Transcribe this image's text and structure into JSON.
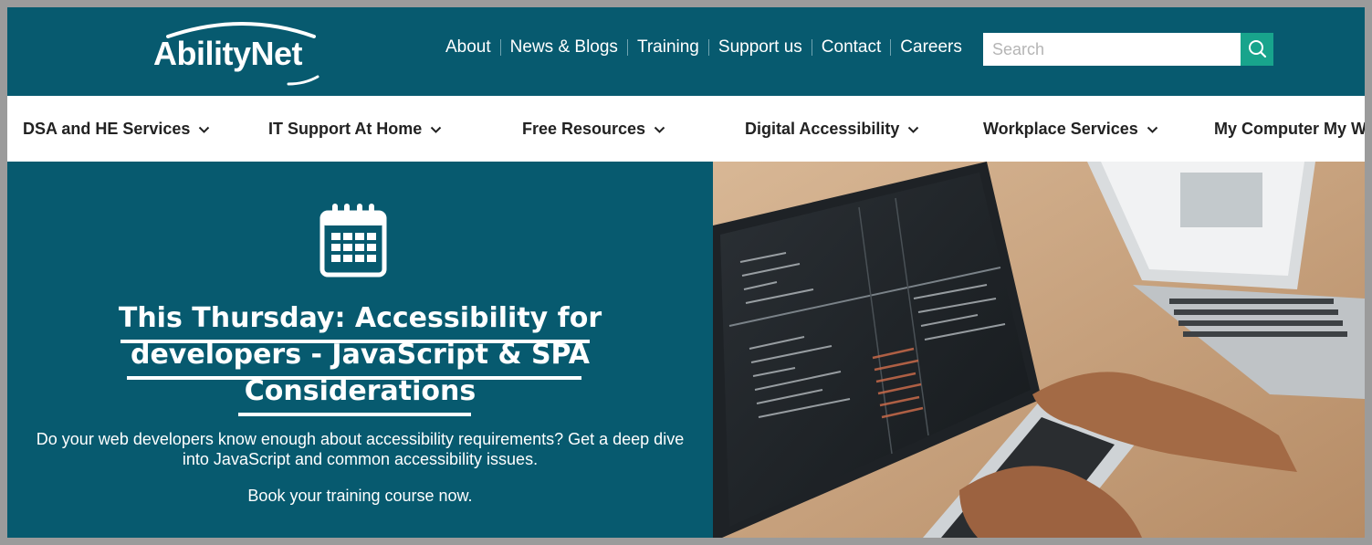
{
  "header": {
    "logo_text": "AbilityNet",
    "top_links": [
      "About",
      "News & Blogs",
      "Training",
      "Support us",
      "Contact",
      "Careers"
    ],
    "search": {
      "placeholder": "Search"
    }
  },
  "main_nav": {
    "items": [
      "DSA and HE Services",
      "IT Support At Home",
      "Free Resources",
      "Digital Accessibility",
      "Workplace Services",
      "My Computer My Way"
    ]
  },
  "hero": {
    "title_lines": [
      "This Thursday: Accessibility for",
      "developers - JavaScript & SPA",
      "Considerations"
    ],
    "description": "Do your web developers know enough about accessibility requirements? Get a deep dive into JavaScript and common accessibility issues.",
    "cta": "Book your training course now."
  },
  "colors": {
    "brand_teal": "#075a6f",
    "search_button": "#18a48c",
    "nav_bg": "#ffffff",
    "nav_text": "#222222"
  },
  "icons": {
    "search": "search-icon",
    "chevron": "chevron-down-icon",
    "calendar": "calendar-icon"
  }
}
